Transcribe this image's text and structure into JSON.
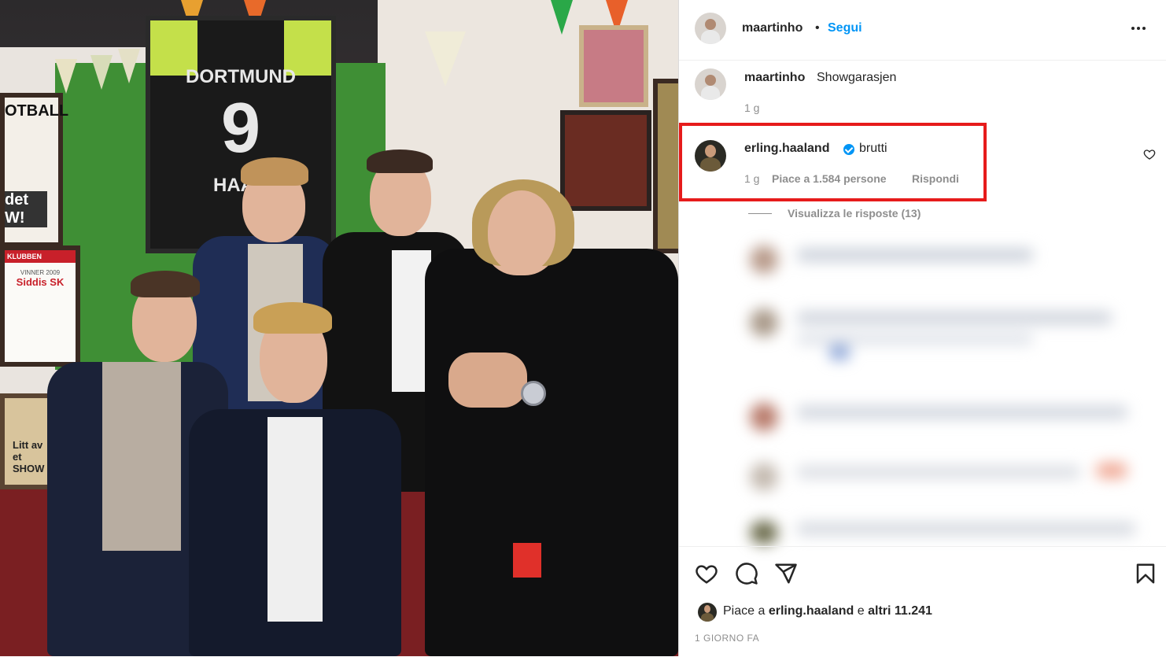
{
  "header": {
    "username": "maartinho",
    "separator": "•",
    "follow_label": "Segui"
  },
  "caption": {
    "username": "maartinho",
    "text": "Showgarasjen",
    "time": "1 g"
  },
  "comment": {
    "username": "erling.haaland",
    "text": "brutti",
    "time": "1 g",
    "likes": "Piace a 1.584 persone",
    "reply_label": "Rispondi",
    "view_replies": "Visualizza le risposte (13)"
  },
  "footer": {
    "likes_prefix": "Piace a",
    "likes_user": "erling.haaland",
    "likes_mid": "e",
    "likes_others": "altri 11.241",
    "timestamp": "1 GIORNO FA"
  },
  "photo": {
    "jersey_name": "DORTMUND",
    "jersey_number": "9",
    "jersey_back": "HAAL",
    "frame_left_text": "OTBALL",
    "poster_text": "det W!",
    "certificate_title": "Siddis SK",
    "certificate_sub": "VINNER 2009",
    "certificate_club": "KLUBBEN",
    "sign_text": "Litt av et SHOW"
  },
  "colors": {
    "accent": "#0095f6",
    "highlight": "#e61b1b",
    "text": "#262626",
    "muted": "#8e8e8e"
  },
  "icons": [
    "more-icon",
    "verified-icon",
    "heart-icon",
    "comment-icon",
    "share-icon",
    "bookmark-icon"
  ]
}
